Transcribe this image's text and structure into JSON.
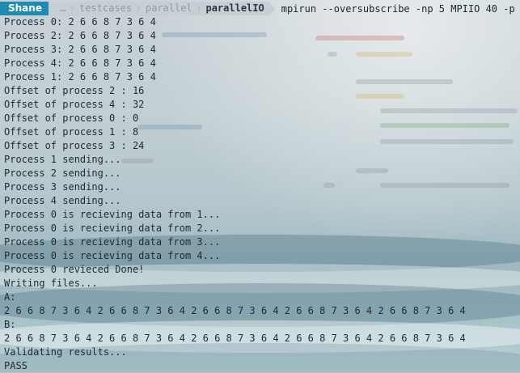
{
  "prompt": {
    "user": "Shane",
    "ellipsis": "…",
    "path": [
      "testcases",
      "parallel"
    ],
    "current_dir": "parallelIO",
    "command": "mpirun --oversubscribe -np 5 MPIIO 40 -p"
  },
  "output": [
    "Process 0: 2 6 6 8 7 3 6 4",
    "Process 2: 2 6 6 8 7 3 6 4",
    "Process 3: 2 6 6 8 7 3 6 4",
    "Process 4: 2 6 6 8 7 3 6 4",
    "Process 1: 2 6 6 8 7 3 6 4",
    "Offset of process 2 : 16",
    "Offset of process 4 : 32",
    "Offset of process 0 : 0",
    "Offset of process 1 : 8",
    "Offset of process 3 : 24",
    "Process 1 sending...",
    "Process 2 sending...",
    "Process 3 sending...",
    "Process 4 sending...",
    "Process 0 is recieving data from 1...",
    "Process 0 is recieving data from 2...",
    "Process 0 is recieving data from 3...",
    "Process 0 is recieving data from 4...",
    "Process 0 revieced Done!",
    "Writing files...",
    "A:",
    "2 6 6 8 7 3 6 4 2 6 6 8 7 3 6 4 2 6 6 8 7 3 6 4 2 6 6 8 7 3 6 4 2 6 6 8 7 3 6 4",
    "B:",
    "2 6 6 8 7 3 6 4 2 6 6 8 7 3 6 4 2 6 6 8 7 3 6 4 2 6 6 8 7 3 6 4 2 6 6 8 7 3 6 4",
    "Validating results...",
    "PASS"
  ],
  "colors": {
    "user_segment": "#1f8bb3",
    "path_segment": "#c6cfd3",
    "text": "#1e2a33"
  }
}
